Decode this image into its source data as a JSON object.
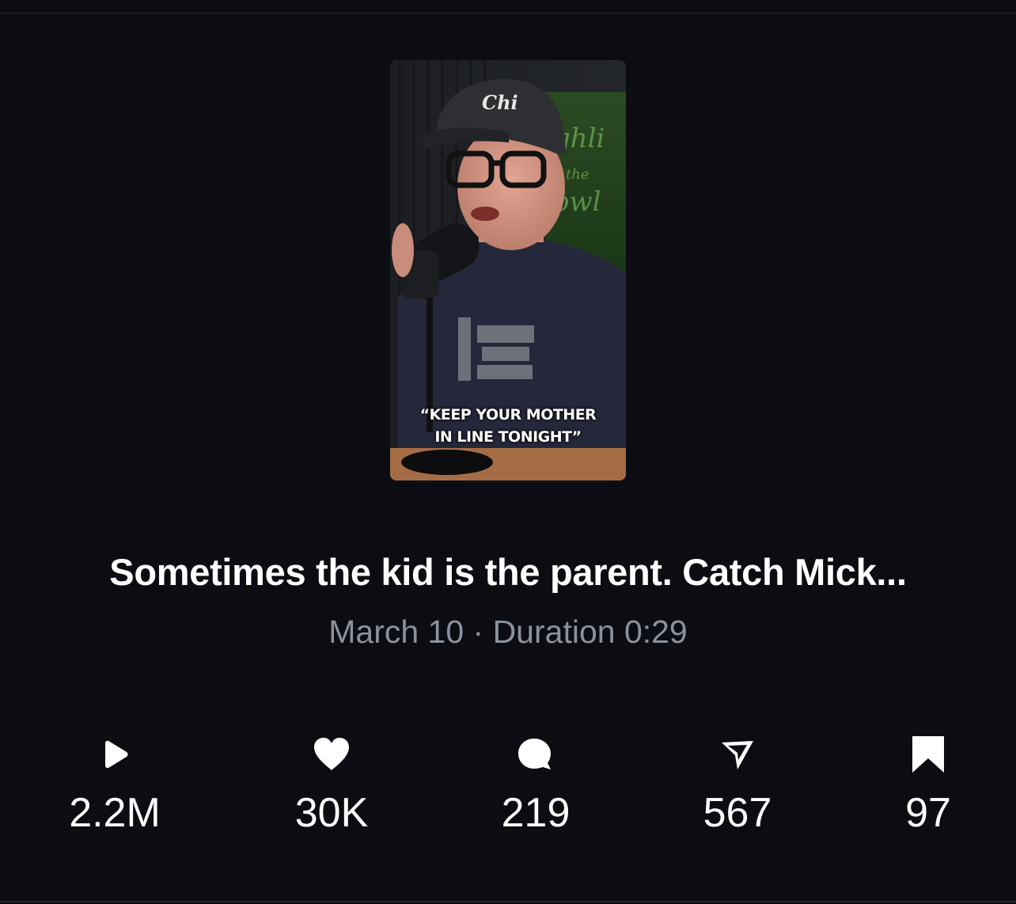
{
  "video": {
    "thumbnail_caption_line1": "“KEEP YOUR MOTHER",
    "thumbnail_caption_line2": "IN LINE TONIGHT”",
    "cap_logo": "Chi",
    "title": "Sometimes the kid is the parent. Catch Mick...",
    "meta": "March 10 · Duration 0:29"
  },
  "stats": [
    {
      "icon": "play-icon",
      "value": "2.2M"
    },
    {
      "icon": "heart-icon",
      "value": "30K"
    },
    {
      "icon": "comment-icon",
      "value": "219"
    },
    {
      "icon": "share-icon",
      "value": "567"
    },
    {
      "icon": "bookmark-icon",
      "value": "97"
    }
  ],
  "colors": {
    "background": "#0b0d12",
    "text_primary": "#ffffff",
    "text_secondary": "#8b929c"
  }
}
